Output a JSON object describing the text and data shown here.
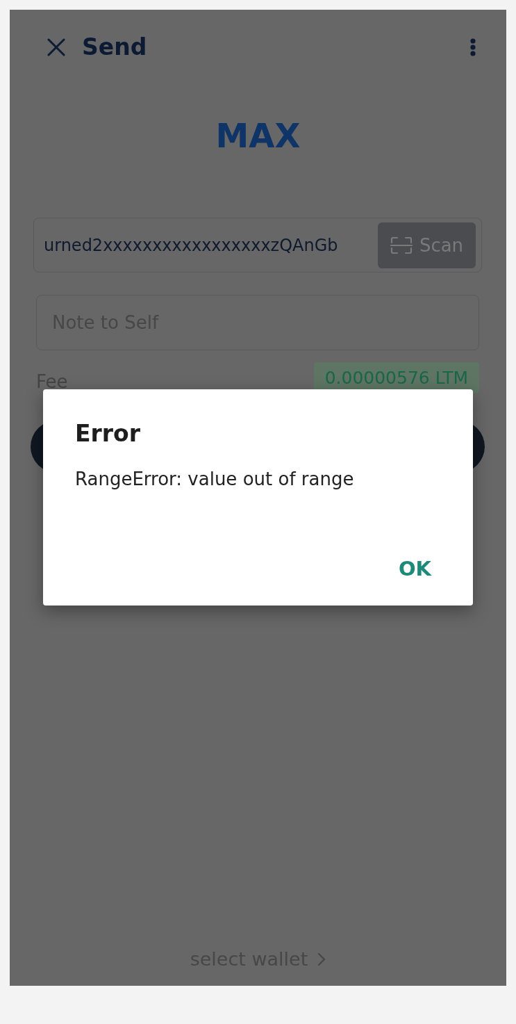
{
  "header": {
    "title": "Send"
  },
  "asset": {
    "name": "MAX"
  },
  "address_field": {
    "value": "urned2xxxxxxxxxxxxxxxxxzQAnGb"
  },
  "scan_button": {
    "label": "Scan"
  },
  "note_field": {
    "placeholder": "Note to Self"
  },
  "fee": {
    "label": "Fee",
    "value": "0.00000576 LTM"
  },
  "dialog": {
    "title": "Error",
    "message": "RangeError: value out of range",
    "buttons": [
      "OK"
    ]
  },
  "footer": {
    "link": "select wallet"
  }
}
